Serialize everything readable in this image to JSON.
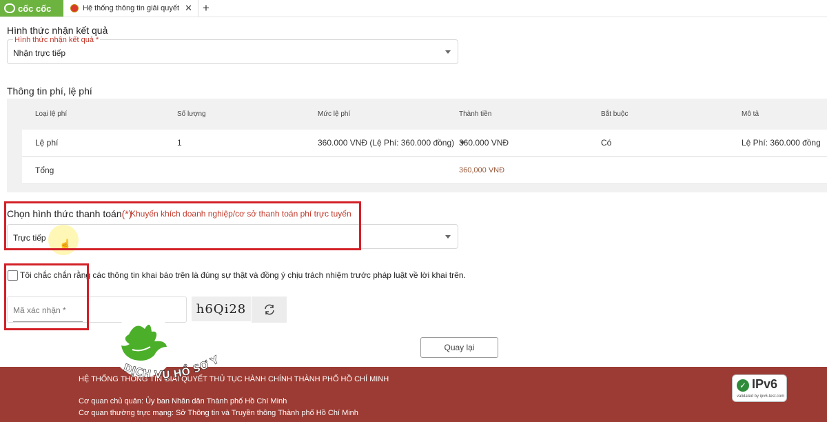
{
  "browser": {
    "brand": "cốc cốc",
    "tab_title": "Hệ thống thông tin giải quyết thủ tục",
    "close_symbol": "✕",
    "newtab_symbol": "+"
  },
  "result_section": {
    "title": "Hình thức nhận kết quả",
    "field_label": "Hình thức nhận kết quả *",
    "value": "Nhận trực tiếp"
  },
  "fee_section": {
    "title": "Thông tin phí, lệ phí",
    "headers": [
      "Loại lệ phí",
      "Số lượng",
      "Mức lệ phí",
      "Thành tiền",
      "Bắt buộc",
      "Mô tả"
    ],
    "row": {
      "type": "Lệ phí",
      "qty": "1",
      "rate": "360.000 VNĐ (Lệ Phí: 360.000 đồng)",
      "amount": "360.000 VNĐ",
      "required": "Có",
      "desc": "Lệ Phí: 360.000 đồng"
    },
    "total_label": "Tổng",
    "total_value": "360,000 VNĐ"
  },
  "payment_section": {
    "title": "Chọn hình thức thanh toán",
    "required_mark": "(*)",
    "hint": "Khuyến khích doanh nghiệp/cơ sở thanh toán phí trực tuyến",
    "value": "Trực tiếp"
  },
  "agreement": {
    "text": "Tôi chắc chắn rằng các thông tin khai báo trên là đúng sự thật và đồng ý chịu trách nhiệm trước pháp luật về lời khai trên."
  },
  "captcha": {
    "placeholder": "Mã xác nhận *",
    "code": "h6Qi28"
  },
  "buttons": {
    "back": "Quay lại"
  },
  "footer": {
    "system_name": "HỆ THỐNG THÔNG TIN GIẢI QUYẾT THỦ TỤC HÀNH CHÍNH THÀNH PHỐ HỒ CHÍ MINH",
    "managing_agency": "Cơ quan chủ quản: Ủy ban Nhân dân Thành phố Hồ Chí Minh",
    "operating_agency": "Cơ quan thường trực mạng: Sở Thông tin và Truyền thông Thành phố Hồ Chí Minh",
    "ipv6_label": "IPv6",
    "ipv6_sub": "validated by ipv6-test.com"
  },
  "watermark": {
    "text": "DỊCH VỤ HỒ SƠ Y DƯỢC"
  },
  "colors": {
    "accent_red": "#d32027",
    "footer_bg": "#9c3b33",
    "brand_green": "#6cb33f"
  }
}
